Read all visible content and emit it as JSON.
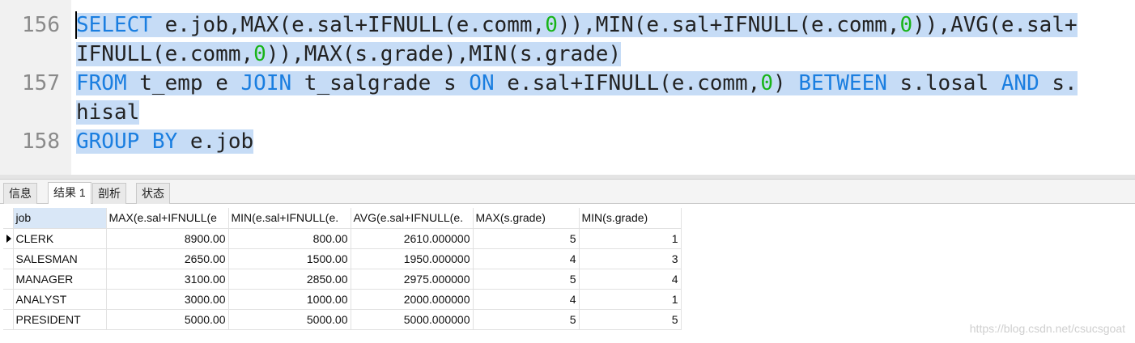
{
  "editor": {
    "line_numbers": [
      "156",
      "157",
      "158"
    ],
    "lines": [
      [
        {
          "t": "SELECT",
          "c": "kw"
        },
        {
          "t": " e.job,MAX(e.sal+IFNULL(e.comm,",
          "c": ""
        },
        {
          "t": "0",
          "c": "num"
        },
        {
          "t": ")),MIN(e.sal+IFNULL(e.comm,",
          "c": ""
        },
        {
          "t": "0",
          "c": "num"
        },
        {
          "t": ")),AVG(e.sal+",
          "c": ""
        }
      ],
      [
        {
          "t": "IFNULL(e.comm,",
          "c": ""
        },
        {
          "t": "0",
          "c": "num"
        },
        {
          "t": ")),MAX(s.grade),MIN(s.grade)",
          "c": ""
        }
      ],
      [
        {
          "t": "FROM",
          "c": "kw"
        },
        {
          "t": " t_emp e ",
          "c": ""
        },
        {
          "t": "JOIN",
          "c": "kw"
        },
        {
          "t": " t_salgrade s ",
          "c": ""
        },
        {
          "t": "ON",
          "c": "kw"
        },
        {
          "t": " e.sal+IFNULL(e.comm,",
          "c": ""
        },
        {
          "t": "0",
          "c": "num"
        },
        {
          "t": ") ",
          "c": ""
        },
        {
          "t": "BETWEEN",
          "c": "kw"
        },
        {
          "t": " s.losal ",
          "c": ""
        },
        {
          "t": "AND",
          "c": "kw"
        },
        {
          "t": " s.",
          "c": ""
        }
      ],
      [
        {
          "t": "hisal",
          "c": ""
        }
      ],
      [
        {
          "t": "GROUP BY",
          "c": "kw"
        },
        {
          "t": " e.job",
          "c": ""
        }
      ]
    ]
  },
  "tabs": [
    "信息",
    "结果 1",
    "剖析",
    "状态"
  ],
  "active_tab": "结果 1",
  "result": {
    "columns": [
      "job",
      "MAX(e.sal+IFNULL(e",
      "MIN(e.sal+IFNULL(e.",
      "AVG(e.sal+IFNULL(e.",
      "MAX(s.grade)",
      "MIN(s.grade)"
    ],
    "rows": [
      [
        "CLERK",
        "8900.00",
        "800.00",
        "2610.000000",
        "5",
        "1"
      ],
      [
        "SALESMAN",
        "2650.00",
        "1500.00",
        "1950.000000",
        "4",
        "3"
      ],
      [
        "MANAGER",
        "3100.00",
        "2850.00",
        "2975.000000",
        "5",
        "4"
      ],
      [
        "ANALYST",
        "3000.00",
        "1000.00",
        "2000.000000",
        "4",
        "1"
      ],
      [
        "PRESIDENT",
        "5000.00",
        "5000.00",
        "5000.000000",
        "5",
        "5"
      ]
    ]
  },
  "watermark": "https://blog.csdn.net/csucsgoat",
  "colors": {
    "keyword": "#1a7ee0",
    "number": "#18b418",
    "selection": "#c6dcf6"
  }
}
